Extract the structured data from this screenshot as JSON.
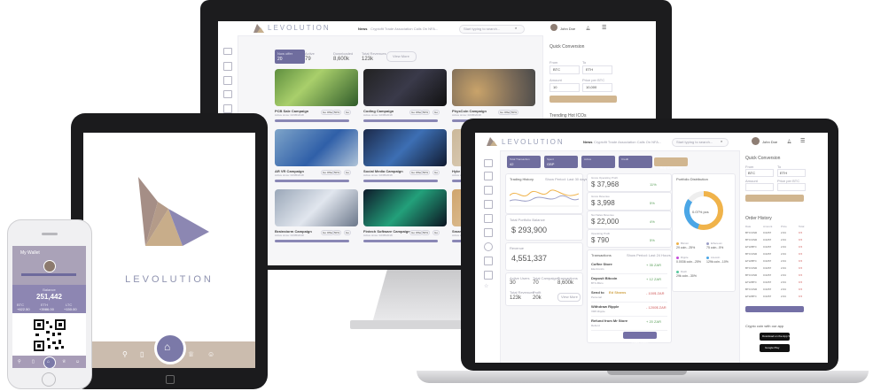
{
  "brand": {
    "name": "LEVOLUTION"
  },
  "imac": {
    "header": {
      "news_label": "News",
      "news_text": "Cryptofit Trade Association Calls On NFA...",
      "search_placeholder": "Start typing to search...",
      "user": "John Doe"
    },
    "stats": {
      "active_label": "Now offer",
      "active_value": "20",
      "s1_label": "Active",
      "s1_value": "79",
      "s2_label": "Downloaded",
      "s2_value": "8,600k",
      "s3_label": "Total Revenues",
      "s3_value": "123k",
      "view_more": "View More"
    },
    "campaigns": [
      {
        "title": "PCB Sale Campaign",
        "sub": "Active since: 02/05/2018",
        "tags": [
          "Go Offer",
          "50%",
          "Go"
        ]
      },
      {
        "title": "Coding Campaign",
        "sub": "Active since: 02/05/2018",
        "tags": [
          "Go Offer",
          "50%",
          "Go"
        ]
      },
      {
        "title": "PhysCoin Campaign",
        "sub": "Active since: 02/05/2018",
        "tags": [
          "Go Offer",
          "50%"
        ]
      },
      {
        "title": "AR VR Campaign",
        "sub": "Active since: 02/05/2018",
        "tags": [
          "Go Offer",
          "50%",
          "Go"
        ]
      },
      {
        "title": "Social Media Campaign",
        "sub": "Active since: 02/05/2018",
        "tags": [
          "Go Offer",
          "50%",
          "Go"
        ]
      },
      {
        "title": "Hybr",
        "sub": "Active since",
        "tags": []
      },
      {
        "title": "Brainstorm Campaign",
        "sub": "Active since: 02/05/2018",
        "tags": [
          "Go Offer",
          "50%",
          "Go"
        ]
      },
      {
        "title": "Fintech Software Campaign",
        "sub": "Active since: 02/05/2018",
        "tags": [
          "Go Offer",
          "50%",
          "Go"
        ]
      },
      {
        "title": "Smar",
        "sub": "Active since",
        "tags": []
      }
    ],
    "right": {
      "title": "Quick Conversion",
      "from_label": "From",
      "to_label": "To",
      "from_val": "BTC",
      "to_val": "ETH",
      "amount_label": "Amount",
      "price_label": "Price per BTC",
      "amount_val": "10",
      "price_val": "10,000",
      "button": "Transfer Now",
      "trending": "Trending Hot ICOs"
    }
  },
  "ipad": {
    "brand": "LEVOLUTION",
    "nav": [
      "location-icon",
      "bookmark-icon",
      "home-icon",
      "trophy-icon",
      "user-icon"
    ]
  },
  "iphone": {
    "title": "My Wallet",
    "balance_label": "Balance",
    "balance": "251,442",
    "left_label": "BTC",
    "left_val": "+622.50",
    "mid_label": "ETH",
    "mid_val": "+3986.00",
    "right_label": "LTC",
    "right_val": "+150.00"
  },
  "mbp": {
    "header": {
      "news_label": "News",
      "news_text": "Cryptofit Trade Association Calls On NFA...",
      "search_placeholder": "Start typing to search...",
      "user": "John Doe"
    },
    "tiles": [
      {
        "label": "Total Transaction",
        "value": "42"
      },
      {
        "label": "Spent",
        "value": "GBP"
      },
      {
        "label": "Active",
        "value": ""
      },
      {
        "label": "Credit",
        "value": ""
      }
    ],
    "buy_button": "Buy Currency",
    "trading": {
      "title": "Trading History",
      "filter": "Show Period: Last 30 days"
    },
    "balances": [
      {
        "label": "Gross Operating Profit",
        "value": "$ 37,968",
        "pct": "11%"
      },
      {
        "label": "Gross Revenue",
        "value": "$ 3,998",
        "pct": "5%"
      },
      {
        "label": "Net Sales Revenue",
        "value": "$ 22,000",
        "pct": "4%"
      },
      {
        "label": "Operating Profit",
        "value": "$ 790",
        "pct": "5%"
      }
    ],
    "portfolio": {
      "title": "Portfolio Distribution",
      "center": "0.07% pcs",
      "legend": [
        {
          "name": "Bitcoin",
          "value": "29 coin...25%",
          "color": "#f0b34a"
        },
        {
          "name": "Ethereum",
          "value": "75 coin...5%",
          "color": "#9b9ec6"
        },
        {
          "name": "Ripple",
          "value": "0.0036 coin...25%",
          "color": "#c44bd9"
        },
        {
          "name": "Litecoin",
          "value": "129k coin...10%",
          "color": "#4aa6e6"
        },
        {
          "name": "Dash",
          "value": "29k coin...30%",
          "color": "#5ac8a0"
        }
      ]
    },
    "total_label": "Total Portfolio Balance",
    "total_value": "$ 293,900",
    "revenue_label": "Revenue",
    "revenue_value": "4,551,337",
    "mini": [
      {
        "label": "Active Users",
        "value": "30"
      },
      {
        "label": "Total Campaigns",
        "value": "70"
      },
      {
        "label": "Transactions",
        "value": "8,600k"
      },
      {
        "label": "Total Revenues",
        "value": "123k"
      },
      {
        "label": "Profit",
        "value": "20k"
      }
    ],
    "view_more": "View More",
    "transactions": {
      "title": "Transactions",
      "filter": "Show Period: Last 24 Hours",
      "items": [
        {
          "name": "Coffee Store",
          "sub": "Electronics",
          "amount": "+ 35 ZAR"
        },
        {
          "name": "Deposit Bitcoin",
          "sub": "BTC-Bitco",
          "amount": "+ 12 ZAR"
        },
        {
          "name": "Send to ",
          "highlight": "Ed Shams",
          "sub": "Personal",
          "amount": "- 100$ ZAR"
        },
        {
          "name": "Withdraw Ripple",
          "sub": "XRP-Ripple",
          "amount": "- 1200$ ZAR"
        },
        {
          "name": "Refund from Mr Store",
          "sub": "Refund",
          "amount": "+ 20 ZAR"
        }
      ],
      "button": "Load More"
    },
    "conversion": {
      "title": "Quick Conversion",
      "from_label": "From",
      "to_label": "To",
      "from_val": "BTC",
      "to_val": "ETH",
      "amount_label": "Amount",
      "price_label": "Price per BTC",
      "button": "Transfer Now"
    },
    "orders": {
      "title": "Order History",
      "cols": [
        "Date",
        "Amount",
        "Price",
        "Total"
      ],
      "rows": [
        [
          "BTC/USD",
          "0.0267",
          "2.64",
          "9.5"
        ],
        [
          "BTC/USD",
          "0.0267",
          "2.64",
          "9.5"
        ],
        [
          "ETH/BTC",
          "0.0267",
          "2.64",
          "9.5"
        ],
        [
          "BTC/USD",
          "0.0267",
          "2.64",
          "9.5"
        ],
        [
          "ETH/BTC",
          "0.0267",
          "2.64",
          "9.5"
        ],
        [
          "BTC/USD",
          "0.0267",
          "2.64",
          "9.5"
        ],
        [
          "BTC/USD",
          "0.0267",
          "2.64",
          "9.5"
        ],
        [
          "ETH/BTC",
          "0.0267",
          "2.64",
          "9.5"
        ],
        [
          "BTC/USD",
          "0.0267",
          "2.64",
          "9.5"
        ],
        [
          "ETH/BTC",
          "0.0267",
          "2.64",
          "9.5"
        ]
      ],
      "button": "Load More"
    },
    "app": {
      "title": "Crypto coin with our app",
      "apple": "Download on the App Store",
      "google": "Google Play"
    }
  },
  "colors": {
    "accent": "#7470a6",
    "gold": "#d1b690",
    "lavender": "#9aa0b8"
  }
}
